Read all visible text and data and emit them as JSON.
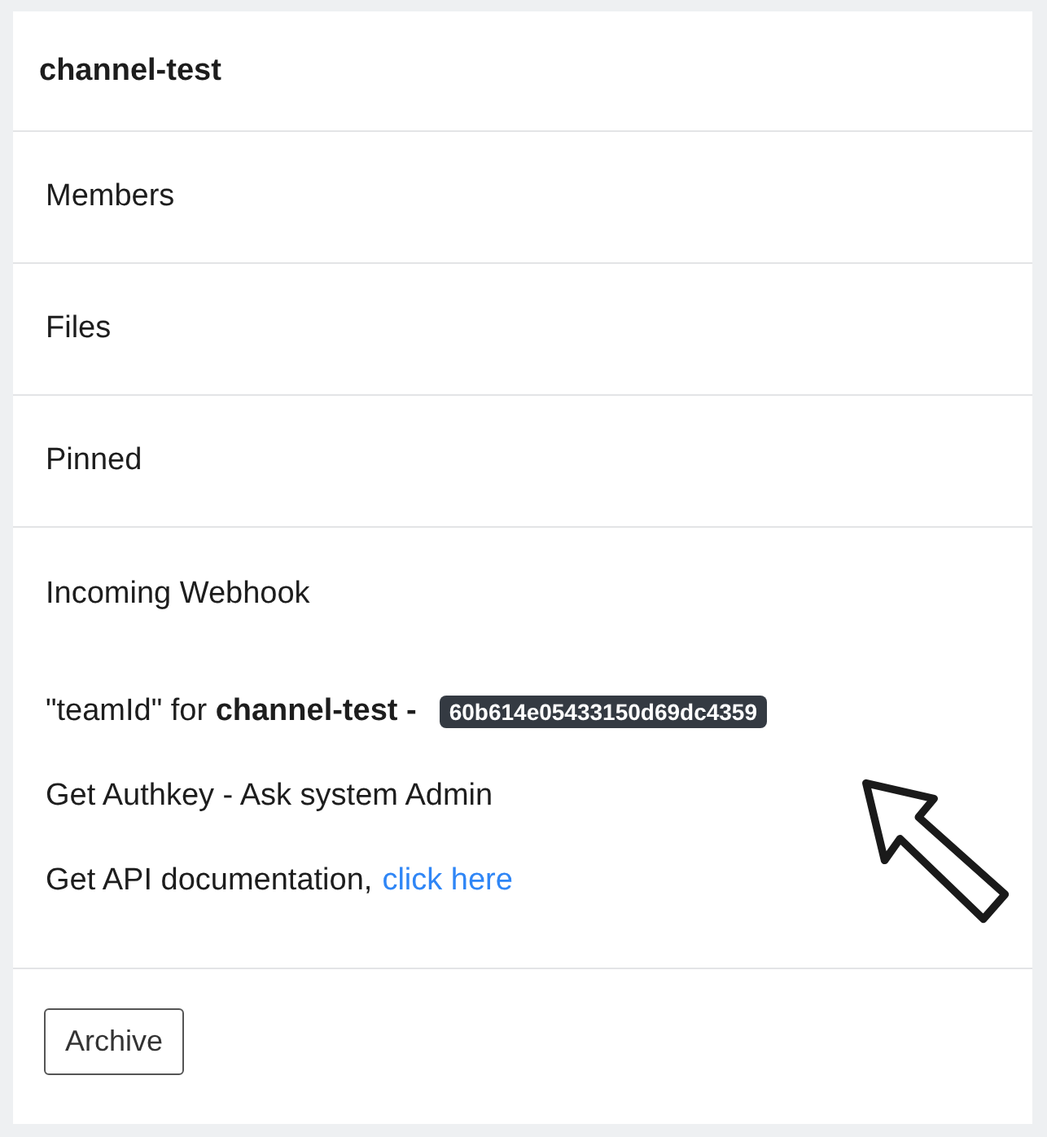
{
  "header": {
    "title": "channel-test"
  },
  "menu_items": [
    "Members",
    "Files",
    "Pinned"
  ],
  "webhook": {
    "title": "Incoming Webhook",
    "team_id_label": "\"teamId\" for **channel-test -**",
    "team_id": "60b614e05433150d69dc4359",
    "authkey_text": "Get Authkey - Ask system Admin",
    "docs_text": "Get API documentation,",
    "docs_link": "click here"
  },
  "footer": {
    "button": "Archive"
  }
}
